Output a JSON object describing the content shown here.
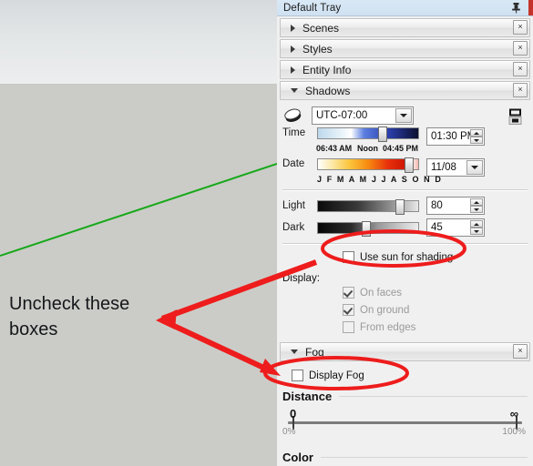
{
  "viewport": {
    "name": "sketchup-3d-viewport",
    "sky_color": "#e3e6e7",
    "ground_color": "#cbccc7",
    "axis_color": "#17a81a"
  },
  "annotation": {
    "text_line1": "Uncheck these",
    "text_line2": "boxes",
    "color": "#ee1c1c"
  },
  "tray": {
    "title": "Default Tray",
    "pin_icon": "pushpin-icon",
    "sections": [
      {
        "label": "Scenes",
        "expanded": false,
        "close_label": "×"
      },
      {
        "label": "Styles",
        "expanded": false,
        "close_label": "×"
      },
      {
        "label": "Entity Info",
        "expanded": false,
        "close_label": "×"
      },
      {
        "label": "Shadows",
        "expanded": true,
        "close_label": "×"
      },
      {
        "label": "Fog",
        "expanded": true,
        "close_label": "×"
      }
    ]
  },
  "shadows": {
    "sun_icon": "shadow-cast-icon",
    "toggle_shadows_icon": "show-shadows-icon",
    "timezone": {
      "value": "UTC-07:00",
      "dropdown_icon": "chevron-down-icon"
    },
    "time": {
      "label": "Time",
      "tick_left": "06:43 AM",
      "tick_mid": "Noon",
      "tick_right": "04:45 PM",
      "value": "01:30 PM",
      "thumb_pct": 60
    },
    "date": {
      "label": "Date",
      "months": "J F M A M J J A S O N D",
      "value": "11/08",
      "thumb_pct": 86
    },
    "light": {
      "label": "Light",
      "value": "80",
      "thumb_pct": 77
    },
    "dark": {
      "label": "Dark",
      "value": "45",
      "thumb_pct": 44
    },
    "use_sun_for_shading": {
      "label": "Use sun for shading",
      "checked": false
    },
    "display_label": "Display:",
    "display_options": [
      {
        "label": "On faces",
        "checked": true,
        "disabled": true
      },
      {
        "label": "On ground",
        "checked": true,
        "disabled": true
      },
      {
        "label": "From edges",
        "checked": false,
        "disabled": true
      }
    ]
  },
  "fog": {
    "display_fog": {
      "label": "Display Fog",
      "checked": false
    },
    "distance": {
      "title": "Distance",
      "top_left": "0",
      "top_right": "∞",
      "bottom_left": "0%",
      "bottom_right": "100%",
      "handle_left_pct": 0,
      "handle_right_pct": 100
    },
    "color_title": "Color"
  }
}
